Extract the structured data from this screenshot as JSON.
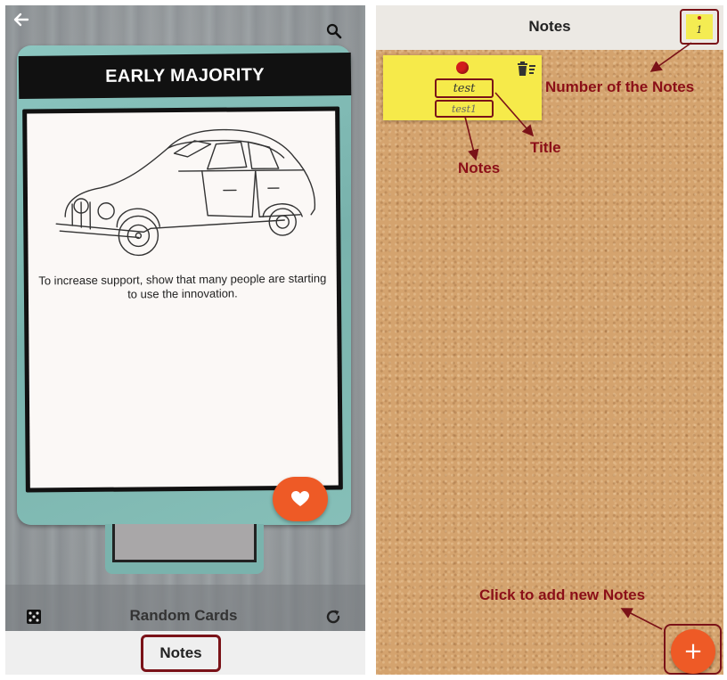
{
  "left_screen": {
    "card": {
      "title": "EARLY MAJORITY",
      "description": "To increase support, show that many people are starting to use the innovation."
    },
    "bottom_bar": {
      "random_label": "Random Cards"
    },
    "nav": {
      "notes_label": "Notes"
    },
    "icons": [
      "back-arrow-icon",
      "search-icon",
      "heart-icon",
      "dice-icon",
      "refresh-icon"
    ]
  },
  "right_screen": {
    "header": {
      "title": "Notes",
      "notes_count": "1"
    },
    "note": {
      "title": "test",
      "body": "test1"
    },
    "add_button": {
      "symbol": "+"
    },
    "icons": [
      "pin-icon",
      "trash-icon",
      "sticky-note-icon",
      "plus-icon"
    ]
  },
  "annotations": {
    "number_of_notes": "Number of the Notes",
    "title": "Title",
    "notes": "Notes",
    "add_new": "Click to add new Notes"
  },
  "colors": {
    "accent_orange": "#ee5a26",
    "annotation_red": "#8b0f18",
    "sticky_yellow": "#f6ea4a",
    "card_teal": "#80bbb4",
    "cork": "#d4a36e"
  }
}
